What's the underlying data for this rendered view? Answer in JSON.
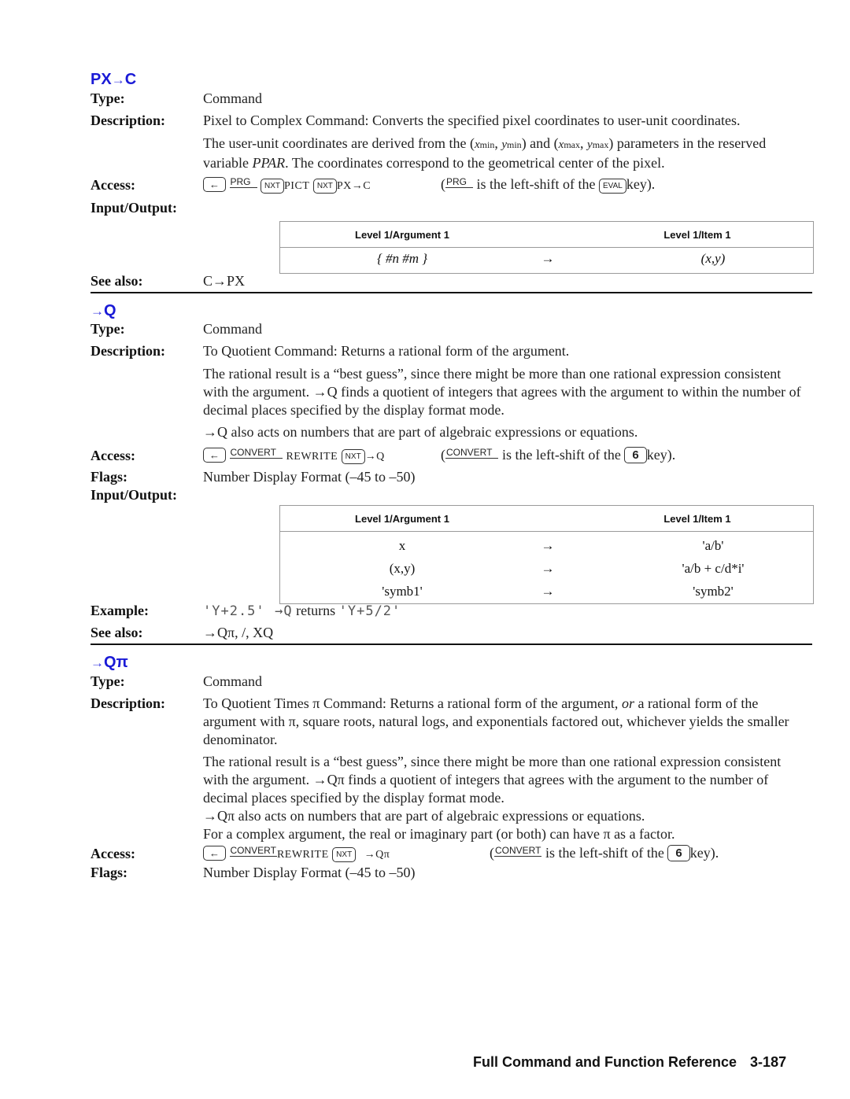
{
  "footer": {
    "section": "Full Command and Function Reference",
    "page": "3-187"
  },
  "labels": {
    "type": "Type:",
    "description": "Description:",
    "access": "Access:",
    "input_output": "Input/Output:",
    "see_also": "See also:",
    "flags": "Flags:",
    "example": "Example:"
  },
  "io_headers": {
    "argument": "Level 1/Argument 1",
    "item": "Level 1/Item 1"
  },
  "arrow": "→",
  "entries": [
    {
      "title_prefix": "PX",
      "title_arrow": "→",
      "title_suffix": "C",
      "type": "Command",
      "description": [
        "Pixel to Complex Command: Converts the specified pixel coordinates to user-unit coordinates.",
        "The user-unit coordinates are derived from the (xmin, ymin) and (xmax, ymax) parameters in the reserved variable PPAR. The coordinates correspond to the geometrical center of the pixel."
      ],
      "access": {
        "keys": [
          "left-shift",
          "PRG",
          "NXT",
          "PICT",
          "NXT",
          "PX→C"
        ],
        "shift_label": "PRG",
        "menu_1": "PICT",
        "menu_2": "PX→C",
        "note_pre": "(",
        "note_post": "is the left-shift of the",
        "note_key": "EVAL",
        "note_end": "key)."
      },
      "io": [
        {
          "arg": "{ #n #m }",
          "result": "(x,y)"
        }
      ],
      "see_also": "C→PX"
    },
    {
      "title_prefix": "",
      "title_arrow": "→",
      "title_suffix": "Q",
      "type": "Command",
      "description": [
        "To Quotient Command: Returns a rational form of the argument.",
        "The rational result is a “best guess”, since there might be more than one rational expression consistent with the argument. →Q finds a quotient of integers that agrees with the argument to within the number of decimal places specified by the display format mode.",
        "→Q also acts on numbers that are part of algebraic expressions or equations."
      ],
      "access": {
        "shift_label": "CONVERT",
        "menu_1": "REWRITE",
        "menu_2": "→Q",
        "note_pre": "(",
        "note_post": "is the left-shift of the",
        "note_key": "6",
        "note_end": "key)."
      },
      "flags": "Number Display Format (–45 to –50)",
      "io": [
        {
          "arg": "x",
          "result": "'a/b'"
        },
        {
          "arg": "(x,y)",
          "result": "'a/b + c/d*i'"
        },
        {
          "arg": "'symb1'",
          "result": "'symb2'"
        }
      ],
      "example": {
        "input": "'Y+2.5'",
        "command": "→Q",
        "word": "returns",
        "output": "'Y+5/2'"
      },
      "see_also": "→Qπ, /, XQ"
    },
    {
      "title_prefix": "",
      "title_arrow": "→",
      "title_suffix": "Qπ",
      "type": "Command",
      "description": [
        "To Quotient Times π Command: Returns a rational form of the argument,",
        "or",
        "a rational form of the argument with π, square roots, natural logs, and exponentials factored out, whichever yields the smaller denominator.",
        "The rational result is a “best guess”, since there might be more than one rational expression consistent with the argument. →Qπ finds a quotient of integers that agrees with the argument to the number of decimal places specified by the display format mode.",
        "→Qπ also acts on numbers that are part of algebraic expressions or equations.",
        "For a complex argument, the real or imaginary part (or both) can have π as a factor."
      ],
      "access": {
        "shift_label": "CONVERT",
        "menu_1": "REWRITE",
        "menu_2": "→Qπ",
        "note_pre": "(",
        "note_post": "is the left-shift of the",
        "note_key": "6",
        "note_end": "key)."
      },
      "flags": "Number Display Format (–45 to –50)"
    }
  ]
}
